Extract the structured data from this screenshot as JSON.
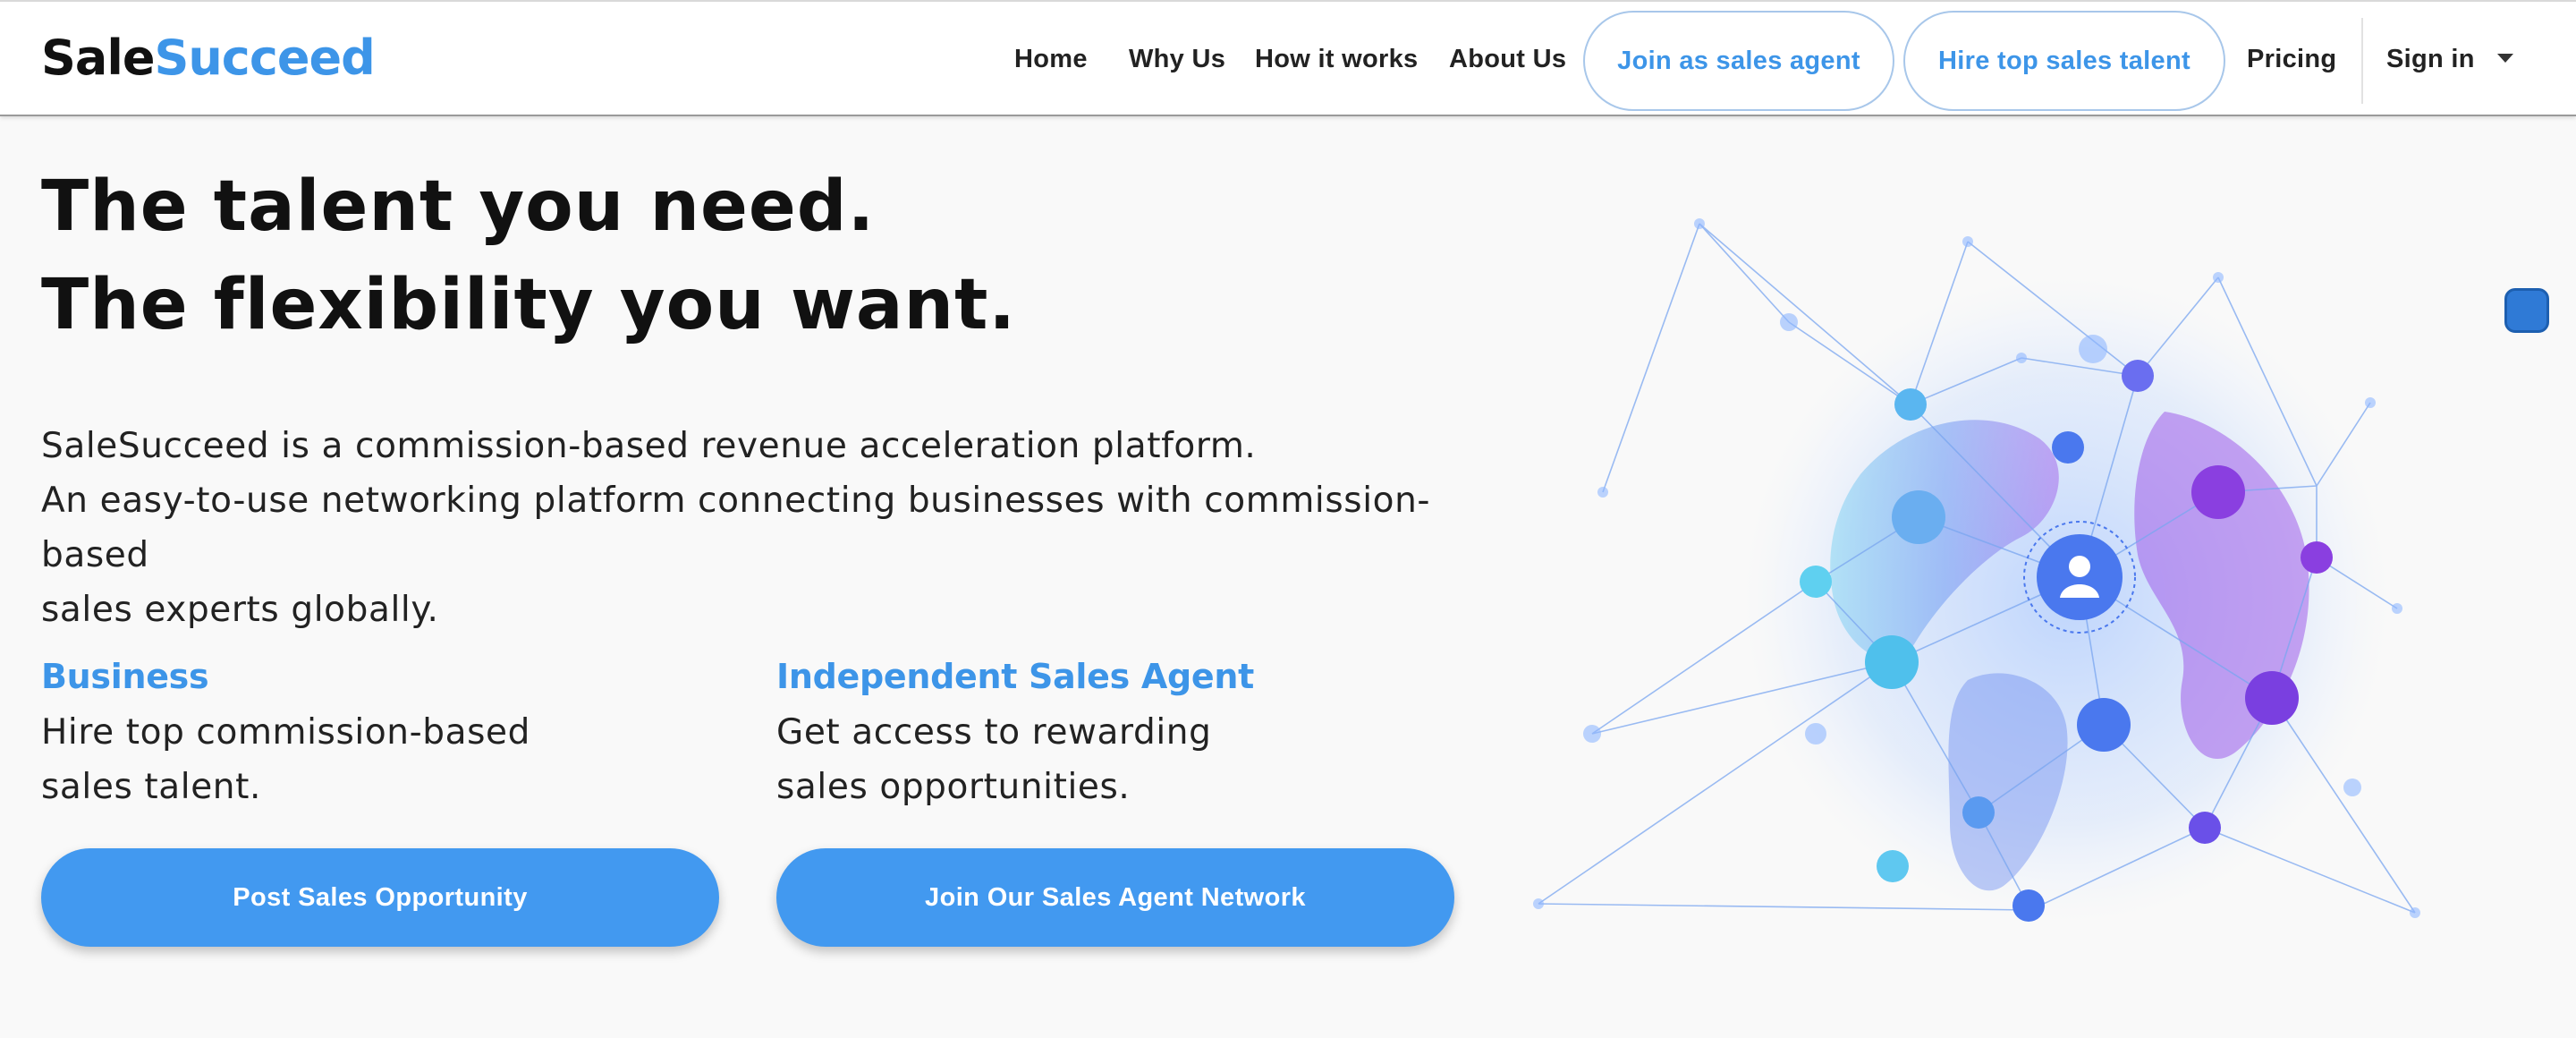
{
  "brand": {
    "part1": "Sale",
    "part2": "Succeed",
    "accent_color": "#3d95e8"
  },
  "nav": {
    "home": "Home",
    "why_us": "Why Us",
    "how_it_works": "How it works",
    "about_us": "About Us",
    "join_agent": "Join as sales agent",
    "hire_talent": "Hire top sales talent",
    "pricing": "Pricing",
    "sign_in": "Sign in"
  },
  "hero": {
    "headline_1": "The talent you need.",
    "headline_2": "The flexibility you want.",
    "desc_1": "SaleSucceed is a commission-based revenue acceleration platform.",
    "desc_2": "An easy-to-use networking platform connecting businesses with commission-based",
    "desc_3": "sales experts globally."
  },
  "business": {
    "title": "Business",
    "line_1": "Hire top commission-based",
    "line_2": "sales talent.",
    "button": "Post Sales Opportunity"
  },
  "agent": {
    "title": "Independent Sales Agent",
    "line_1": "Get access to rewarding",
    "line_2": "sales opportunities.",
    "button": "Join Our Sales Agent Network"
  },
  "icons": {
    "dropdown": "chevron-down-icon",
    "illustration": "global-network-illustration",
    "chat": "chat-widget-icon"
  },
  "colors": {
    "button": "#4299f0",
    "pill_border": "#a8c7ea",
    "text": "#111111"
  }
}
